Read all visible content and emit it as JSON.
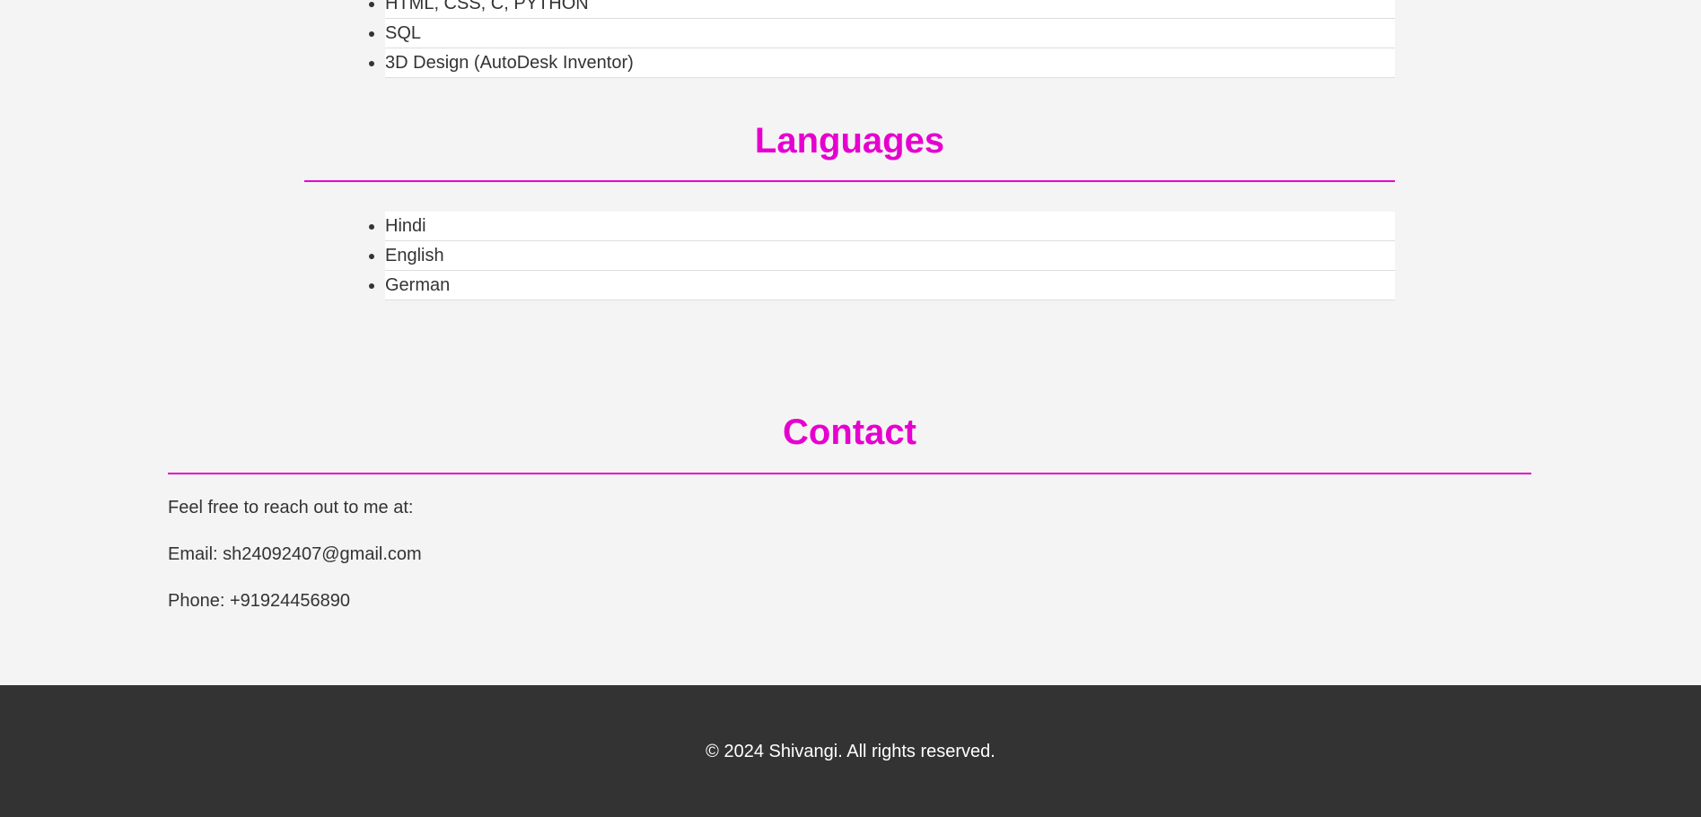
{
  "skills": {
    "items": [
      "HTML, CSS, C, PYTHON",
      "SQL",
      "3D Design (AutoDesk Inventor)"
    ]
  },
  "languages": {
    "title": "Languages",
    "items": [
      "Hindi",
      "English",
      "German"
    ]
  },
  "contact": {
    "title": "Contact",
    "intro": "Feel free to reach out to me at:",
    "email": "Email: sh24092407@gmail.com",
    "phone": "Phone: +91924456890"
  },
  "footer": {
    "text": "© 2024 Shivangi. All rights reserved."
  },
  "colors": {
    "accent": "#e600cf",
    "background": "#f4f4f4",
    "footer_bg": "#333333",
    "text": "#333333"
  }
}
